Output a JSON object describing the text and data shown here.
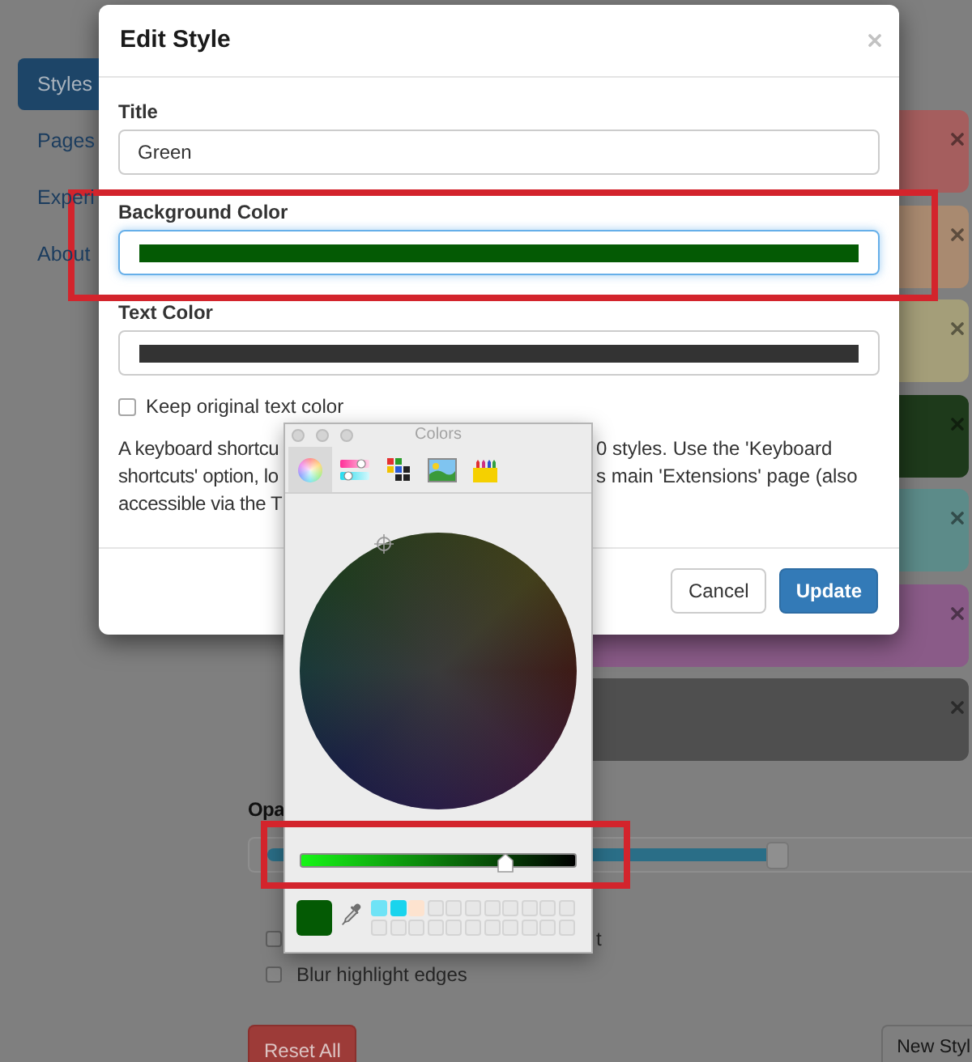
{
  "sidebar": {
    "items": [
      {
        "label": "Styles",
        "selected": true
      },
      {
        "label": "Pages",
        "selected": false
      },
      {
        "label": "Experi",
        "selected": false
      },
      {
        "label": "About",
        "selected": false
      }
    ]
  },
  "styles": [
    {
      "color": "#a55e5e"
    },
    {
      "color": "#a98a70"
    },
    {
      "color": "#a49e79"
    },
    {
      "color": "#1e3a1b"
    },
    {
      "color": "#5c8b89"
    },
    {
      "color": "#8a5b88"
    },
    {
      "color": "#4f4f4f"
    }
  ],
  "opacity": {
    "label": "Opa",
    "level": 0.74
  },
  "options": [
    {
      "label_tail": "t",
      "checked": false
    },
    {
      "label": "Blur highlight edges",
      "checked": false
    }
  ],
  "buttons": [
    {
      "label": "Reset All",
      "kind": "danger"
    },
    {
      "label": "New Styl",
      "kind": "default"
    }
  ],
  "dialog": {
    "title": "Edit Style",
    "fields": [
      {
        "kind": "text",
        "label": "Title",
        "value": "Green"
      },
      {
        "kind": "color",
        "label": "Background Color",
        "color": "#045a04",
        "focused": true
      },
      {
        "kind": "color",
        "label": "Text Color",
        "color": "#333333",
        "focused": false
      }
    ],
    "keep_text_color": {
      "label": "Keep original text color",
      "checked": false
    },
    "note_lines": [
      {
        "left": "A keyboard shortcu",
        "right": "0 styles. Use the 'Keyboard"
      },
      {
        "left": "shortcuts' option, lo",
        "right": "s main 'Extensions' page (also"
      },
      {
        "left": "accessible via the T"
      }
    ],
    "buttons": [
      {
        "label": "Cancel",
        "kind": "default"
      },
      {
        "label": "Update",
        "kind": "primary"
      }
    ]
  },
  "color_picker": {
    "title": "Colors",
    "modes": [
      {
        "kind": "wheel",
        "selected": true
      },
      {
        "kind": "sliders",
        "selected": false
      },
      {
        "kind": "palettes",
        "selected": false
      },
      {
        "kind": "image",
        "selected": false
      },
      {
        "kind": "crayons",
        "selected": false
      }
    ],
    "brightness": {
      "level": 0.74
    },
    "well": {
      "color": "#045a04"
    },
    "swatches": [
      {
        "color": "#6fe3f6"
      },
      {
        "color": "#19d4ed"
      },
      {
        "color": "#fde3cf"
      }
    ]
  }
}
